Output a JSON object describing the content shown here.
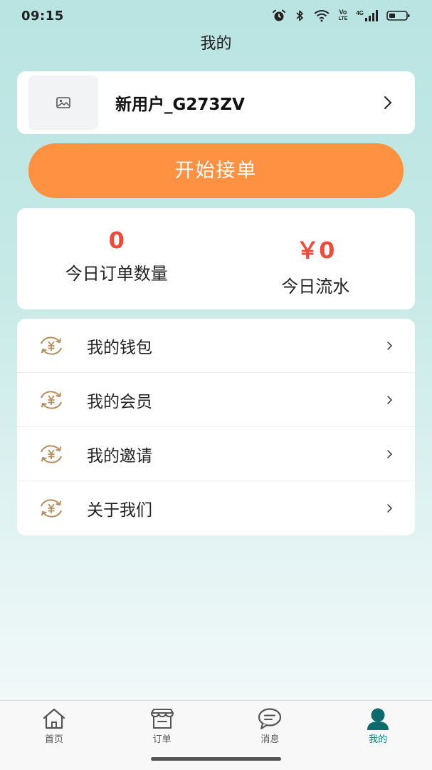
{
  "status_bar": {
    "time": "09:15",
    "icons": [
      "alarm-icon",
      "bluetooth-icon",
      "wifi-icon",
      "volte-icon",
      "signal-4g-icon",
      "battery-icon"
    ],
    "volte_top": "Vo",
    "volte_bottom": "LTE",
    "network": "4G"
  },
  "header": {
    "title": "我的"
  },
  "profile": {
    "username": "新用户_G273ZV",
    "avatar_icon": "image-placeholder-icon"
  },
  "start_button": {
    "label": "开始接单",
    "color": "#ff9142"
  },
  "stats": {
    "orders_today": {
      "value": "0",
      "label": "今日订单数量"
    },
    "revenue_today": {
      "value": "￥0",
      "label": "今日流水"
    },
    "value_color": "#f04a3a"
  },
  "menu": {
    "items": [
      {
        "label": "我的钱包",
        "icon": "yuan-exchange-icon"
      },
      {
        "label": "我的会员",
        "icon": "yuan-exchange-icon"
      },
      {
        "label": "我的邀请",
        "icon": "yuan-exchange-icon"
      },
      {
        "label": "关于我们",
        "icon": "yuan-exchange-icon"
      }
    ]
  },
  "tab_bar": {
    "tabs": [
      {
        "label": "首页",
        "icon": "home-icon",
        "active": false
      },
      {
        "label": "订单",
        "icon": "store-icon",
        "active": false
      },
      {
        "label": "消息",
        "icon": "chat-icon",
        "active": false
      },
      {
        "label": "我的",
        "icon": "person-icon",
        "active": true
      }
    ],
    "active_color": "#0e7c7e"
  }
}
